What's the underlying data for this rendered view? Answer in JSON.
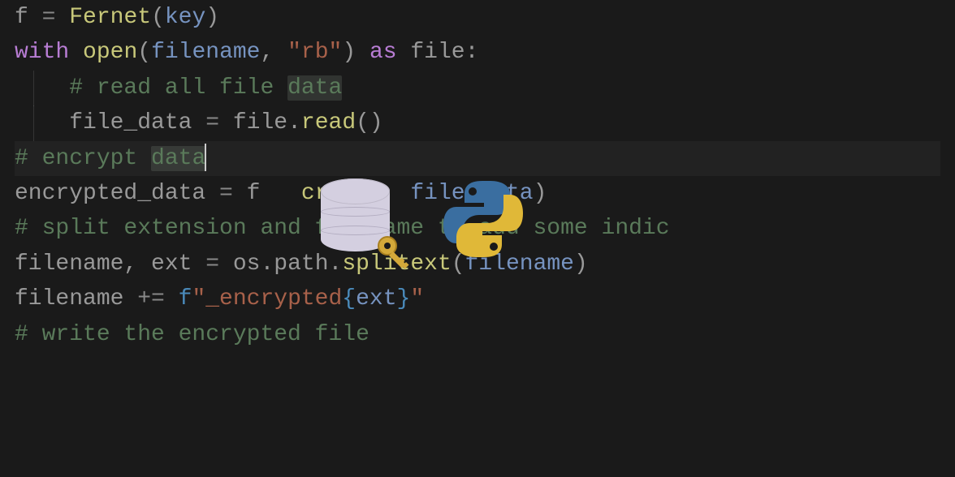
{
  "code": {
    "line1": {
      "var_f": "f",
      "eq": " = ",
      "func": "Fernet",
      "open_paren": "(",
      "arg": "key",
      "close_paren": ")"
    },
    "line2": {
      "with": "with",
      "space1": " ",
      "open": "open",
      "open_paren": "(",
      "arg1": "filename",
      "comma": ", ",
      "string": "\"rb\"",
      "close_paren": ")",
      "space2": " ",
      "as": "as",
      "space3": " ",
      "var": "file",
      "colon": ":"
    },
    "line3": {
      "indent": "    ",
      "comment_prefix": "# read all file ",
      "comment_word": "data"
    },
    "line4": {
      "indent": "    ",
      "var": "file_data",
      "eq": " = ",
      "obj": "file",
      "dot": ".",
      "method": "read",
      "parens": "()"
    },
    "line5": {
      "comment_prefix": "# encrypt ",
      "comment_word": "data"
    },
    "line6": {
      "var": "encrypted_data",
      "eq": " = ",
      "obj": "f",
      "dot": ".",
      "method_partial": "crypt",
      "open_paren": "(",
      "arg": "file_data",
      "close_paren": ")"
    },
    "line7": {
      "comment": "# split extension and filename to add some indic"
    },
    "line8": {
      "var1": "filename",
      "comma": ", ",
      "var2": "ext",
      "eq": " = ",
      "obj1": "os",
      "dot1": ".",
      "obj2": "path",
      "dot2": ".",
      "method": "splitext",
      "open_paren": "(",
      "arg": "filename",
      "close_paren": ")"
    },
    "line9": {
      "var": "filename",
      "op": " += ",
      "fprefix": "f",
      "str1": "\"_encrypted",
      "brace_open": "{",
      "inner": "ext",
      "brace_close": "}",
      "str2": "\""
    },
    "line10": {
      "comment": "# write the encrypted file"
    }
  },
  "icons": {
    "database": "database-icon",
    "key": "key-icon",
    "python": "python-logo-icon"
  }
}
